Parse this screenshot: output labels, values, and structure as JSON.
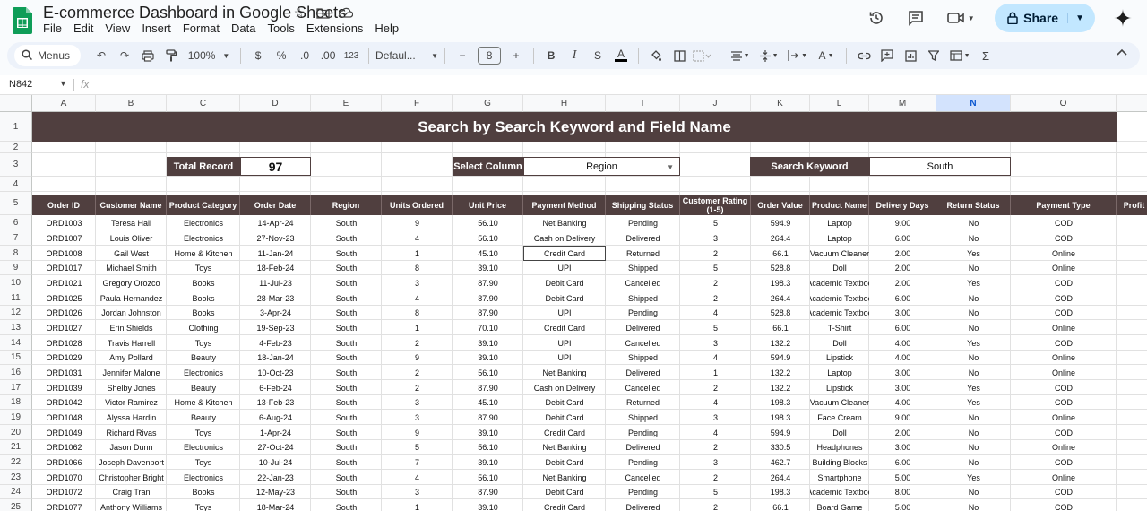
{
  "doc": {
    "title": "E-commerce Dashboard in Google Sheets",
    "menu": [
      "File",
      "Edit",
      "View",
      "Insert",
      "Format",
      "Data",
      "Tools",
      "Extensions",
      "Help"
    ],
    "share_label": "Share"
  },
  "toolbar": {
    "menus_label": "Menus",
    "zoom": "100%",
    "currency": "$",
    "percent": "%",
    "dec_decrease": ".0",
    "dec_increase": ".00",
    "number_format": "123",
    "font": "Defaul...",
    "font_size": "8"
  },
  "formula_bar": {
    "cell_ref": "N842",
    "fx": "fx"
  },
  "columns": [
    "A",
    "B",
    "C",
    "D",
    "E",
    "F",
    "G",
    "H",
    "I",
    "J",
    "K",
    "L",
    "M",
    "N",
    "O",
    ""
  ],
  "selected_column": "N",
  "rows": [
    "1",
    "2",
    "3",
    "4",
    "5",
    "6",
    "7",
    "8",
    "9",
    "10",
    "11",
    "12",
    "13",
    "14",
    "15",
    "16",
    "17",
    "18",
    "19",
    "20",
    "21",
    "22",
    "23",
    "24",
    "25"
  ],
  "banner": "Search by Search Keyword and Field Name",
  "search": {
    "total_label": "Total Record",
    "total_value": "97",
    "column_label": "Select Column",
    "column_value": "Region",
    "keyword_label": "Search Keyword",
    "keyword_value": "South"
  },
  "headers": [
    "Order ID",
    "Customer Name",
    "Product Category",
    "Order Date",
    "Region",
    "Units Ordered",
    "Unit Price",
    "Payment Method",
    "Shipping Status",
    "Customer Rating (1-5)",
    "Order Value",
    "Product Name",
    "Delivery Days",
    "Return Status",
    "Payment Type",
    "Profit"
  ],
  "table": [
    [
      "ORD1003",
      "Teresa Hall",
      "Electronics",
      "14-Apr-24",
      "South",
      "9",
      "56.10",
      "Net Banking",
      "Pending",
      "5",
      "594.9",
      "Laptop",
      "9.00",
      "No",
      "COD"
    ],
    [
      "ORD1007",
      "Louis Oliver",
      "Electronics",
      "27-Nov-23",
      "South",
      "4",
      "56.10",
      "Cash on Delivery",
      "Delivered",
      "3",
      "264.4",
      "Laptop",
      "6.00",
      "No",
      "COD"
    ],
    [
      "ORD1008",
      "Gail West",
      "Home & Kitchen",
      "11-Jan-24",
      "South",
      "1",
      "45.10",
      "Credit Card",
      "Returned",
      "2",
      "66.1",
      "Vacuum Cleaner",
      "2.00",
      "Yes",
      "Online"
    ],
    [
      "ORD1017",
      "Michael Smith",
      "Toys",
      "18-Feb-24",
      "South",
      "8",
      "39.10",
      "UPI",
      "Shipped",
      "5",
      "528.8",
      "Doll",
      "2.00",
      "No",
      "Online"
    ],
    [
      "ORD1021",
      "Gregory Orozco",
      "Books",
      "11-Jul-23",
      "South",
      "3",
      "87.90",
      "Debit Card",
      "Cancelled",
      "2",
      "198.3",
      "Academic Textboo",
      "2.00",
      "Yes",
      "COD"
    ],
    [
      "ORD1025",
      "Paula Hernandez",
      "Books",
      "28-Mar-23",
      "South",
      "4",
      "87.90",
      "Debit Card",
      "Shipped",
      "2",
      "264.4",
      "Academic Textboo",
      "6.00",
      "No",
      "COD"
    ],
    [
      "ORD1026",
      "Jordan Johnston",
      "Books",
      "3-Apr-24",
      "South",
      "8",
      "87.90",
      "UPI",
      "Pending",
      "4",
      "528.8",
      "Academic Textboo",
      "3.00",
      "No",
      "COD"
    ],
    [
      "ORD1027",
      "Erin Shields",
      "Clothing",
      "19-Sep-23",
      "South",
      "1",
      "70.10",
      "Credit Card",
      "Delivered",
      "5",
      "66.1",
      "T-Shirt",
      "6.00",
      "No",
      "Online"
    ],
    [
      "ORD1028",
      "Travis Harrell",
      "Toys",
      "4-Feb-23",
      "South",
      "2",
      "39.10",
      "UPI",
      "Cancelled",
      "3",
      "132.2",
      "Doll",
      "4.00",
      "Yes",
      "COD"
    ],
    [
      "ORD1029",
      "Amy Pollard",
      "Beauty",
      "18-Jan-24",
      "South",
      "9",
      "39.10",
      "UPI",
      "Shipped",
      "4",
      "594.9",
      "Lipstick",
      "4.00",
      "No",
      "Online"
    ],
    [
      "ORD1031",
      "Jennifer Malone",
      "Electronics",
      "10-Oct-23",
      "South",
      "2",
      "56.10",
      "Net Banking",
      "Delivered",
      "1",
      "132.2",
      "Laptop",
      "3.00",
      "No",
      "Online"
    ],
    [
      "ORD1039",
      "Shelby Jones",
      "Beauty",
      "6-Feb-24",
      "South",
      "2",
      "87.90",
      "Cash on Delivery",
      "Cancelled",
      "2",
      "132.2",
      "Lipstick",
      "3.00",
      "Yes",
      "COD"
    ],
    [
      "ORD1042",
      "Victor Ramirez",
      "Home & Kitchen",
      "13-Feb-23",
      "South",
      "3",
      "45.10",
      "Debit Card",
      "Returned",
      "4",
      "198.3",
      "Vacuum Cleaner",
      "4.00",
      "Yes",
      "COD"
    ],
    [
      "ORD1048",
      "Alyssa Hardin",
      "Beauty",
      "6-Aug-24",
      "South",
      "3",
      "87.90",
      "Debit Card",
      "Shipped",
      "3",
      "198.3",
      "Face Cream",
      "9.00",
      "No",
      "Online"
    ],
    [
      "ORD1049",
      "Richard Rivas",
      "Toys",
      "1-Apr-24",
      "South",
      "9",
      "39.10",
      "Credit Card",
      "Pending",
      "4",
      "594.9",
      "Doll",
      "2.00",
      "No",
      "COD"
    ],
    [
      "ORD1062",
      "Jason Dunn",
      "Electronics",
      "27-Oct-24",
      "South",
      "5",
      "56.10",
      "Net Banking",
      "Delivered",
      "2",
      "330.5",
      "Headphones",
      "3.00",
      "No",
      "Online"
    ],
    [
      "ORD1066",
      "Joseph Davenport",
      "Toys",
      "10-Jul-24",
      "South",
      "7",
      "39.10",
      "Debit Card",
      "Pending",
      "3",
      "462.7",
      "Building Blocks",
      "6.00",
      "No",
      "COD"
    ],
    [
      "ORD1070",
      "Christopher Bright",
      "Electronics",
      "22-Jan-23",
      "South",
      "4",
      "56.10",
      "Net Banking",
      "Cancelled",
      "2",
      "264.4",
      "Smartphone",
      "5.00",
      "Yes",
      "Online"
    ],
    [
      "ORD1072",
      "Craig Tran",
      "Books",
      "12-May-23",
      "South",
      "3",
      "87.90",
      "Debit Card",
      "Pending",
      "5",
      "198.3",
      "Academic Textboo",
      "8.00",
      "No",
      "COD"
    ],
    [
      "ORD1077",
      "Anthony Williams",
      "Toys",
      "18-Mar-24",
      "South",
      "1",
      "39.10",
      "Credit Card",
      "Delivered",
      "2",
      "66.1",
      "Board Game",
      "5.00",
      "No",
      "COD"
    ]
  ]
}
